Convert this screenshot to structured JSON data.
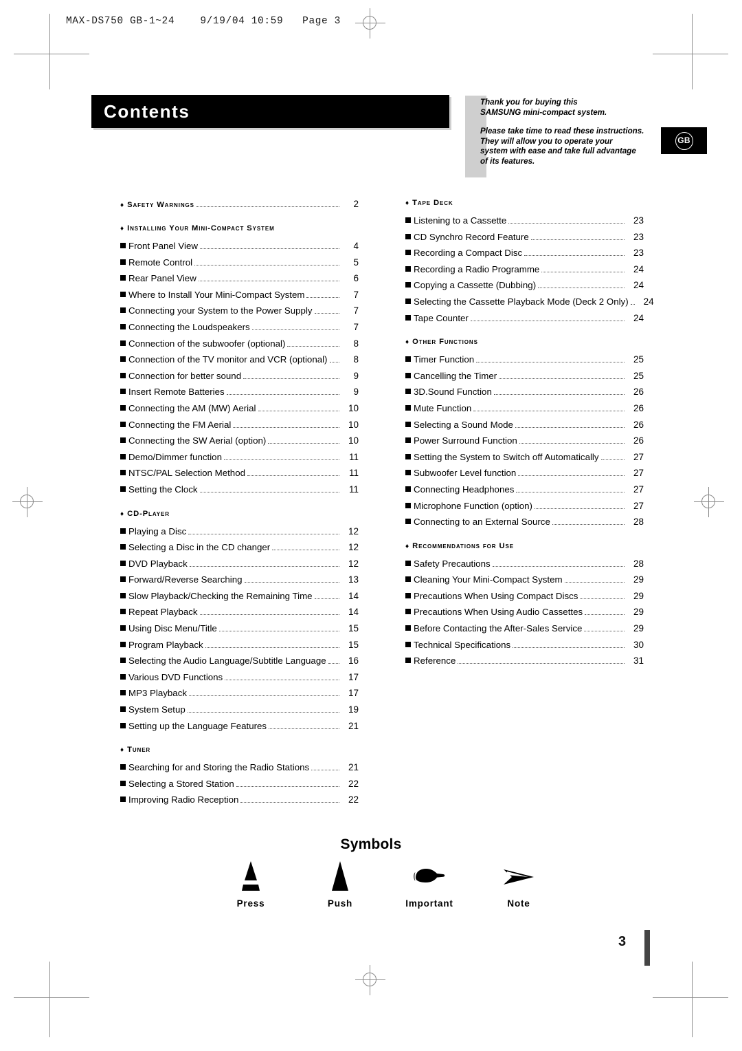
{
  "file_header": "MAX-DS750 GB-1~24    9/19/04 10:59   Page 3",
  "banner": {
    "title": "Contents"
  },
  "intro": {
    "paragraph1_line1": "Thank you for buying this",
    "paragraph1_line2": "SAMSUNG mini-compact system.",
    "paragraph2_line1": "Please take time to read these instructions.",
    "paragraph2_line2": "They will allow you to operate your",
    "paragraph2_line3": "system with ease and take full advantage",
    "paragraph2_line4": "of its features."
  },
  "region_badge": {
    "label": "GB"
  },
  "toc": {
    "left_column": [
      {
        "type": "section_with_page",
        "label": "Safety Warnings",
        "page": "2",
        "entries": []
      },
      {
        "type": "section",
        "label": "Installing Your Mini-Compact System",
        "entries": [
          {
            "label": "Front Panel View",
            "page": "4"
          },
          {
            "label": "Remote Control",
            "page": "5"
          },
          {
            "label": "Rear Panel View",
            "page": "6"
          },
          {
            "label": "Where to Install Your Mini-Compact System",
            "page": "7"
          },
          {
            "label": "Connecting your System to the Power Supply",
            "page": "7"
          },
          {
            "label": "Connecting the Loudspeakers",
            "page": "7"
          },
          {
            "label": "Connection of the subwoofer (optional)",
            "page": "8"
          },
          {
            "label": "Connection of the TV monitor and VCR (optional)",
            "page": "8"
          },
          {
            "label": "Connection for better sound",
            "page": "9"
          },
          {
            "label": "Insert Remote Batteries",
            "page": "9"
          },
          {
            "label": "Connecting the AM (MW) Aerial",
            "page": "10"
          },
          {
            "label": "Connecting the FM Aerial",
            "page": "10"
          },
          {
            "label": "Connecting the SW Aerial (option)",
            "page": "10"
          },
          {
            "label": "Demo/Dimmer function",
            "page": "11"
          },
          {
            "label": "NTSC/PAL Selection Method",
            "page": "11"
          },
          {
            "label": "Setting the Clock",
            "page": "11"
          }
        ]
      },
      {
        "type": "section",
        "label": "CD-Player",
        "entries": [
          {
            "label": "Playing a Disc",
            "page": "12"
          },
          {
            "label": "Selecting a Disc in the CD changer",
            "page": "12"
          },
          {
            "label": "DVD Playback",
            "page": "12"
          },
          {
            "label": "Forward/Reverse Searching",
            "page": "13"
          },
          {
            "label": "Slow Playback/Checking the Remaining Time",
            "page": "14"
          },
          {
            "label": "Repeat Playback",
            "page": "14"
          },
          {
            "label": "Using Disc Menu/Title",
            "page": "15"
          },
          {
            "label": "Program Playback",
            "page": "15"
          },
          {
            "label": "Selecting the Audio Language/Subtitle Language",
            "page": "16"
          },
          {
            "label": "Various DVD Functions",
            "page": "17"
          },
          {
            "label": "MP3 Playback",
            "page": "17"
          },
          {
            "label": "System Setup",
            "page": "19"
          },
          {
            "label": "Setting up the Language Features",
            "page": "21"
          }
        ]
      },
      {
        "type": "section",
        "label": "Tuner",
        "entries": [
          {
            "label": "Searching for and Storing the Radio Stations",
            "page": "21"
          },
          {
            "label": "Selecting a Stored Station",
            "page": "22"
          },
          {
            "label": "Improving Radio Reception",
            "page": "22"
          }
        ]
      }
    ],
    "right_column": [
      {
        "type": "section",
        "label": "Tape Deck",
        "entries": [
          {
            "label": "Listening to a Cassette",
            "page": "23"
          },
          {
            "label": "CD Synchro Record Feature",
            "page": "23"
          },
          {
            "label": "Recording a Compact Disc",
            "page": "23"
          },
          {
            "label": "Recording a Radio Programme",
            "page": "24"
          },
          {
            "label": "Copying a Cassette (Dubbing)",
            "page": "24"
          },
          {
            "label": "Selecting the Cassette Playback Mode (Deck 2 Only)",
            "page": "24"
          },
          {
            "label": "Tape Counter",
            "page": "24"
          }
        ]
      },
      {
        "type": "section",
        "label": "Other Functions",
        "entries": [
          {
            "label": "Timer Function",
            "page": "25"
          },
          {
            "label": "Cancelling the Timer",
            "page": "25"
          },
          {
            "label": "3D.Sound Function",
            "page": "26"
          },
          {
            "label": "Mute Function",
            "page": "26"
          },
          {
            "label": "Selecting a Sound Mode",
            "page": "26"
          },
          {
            "label": "Power Surround Function",
            "page": "26"
          },
          {
            "label": "Setting the System to Switch off Automatically",
            "page": "27"
          },
          {
            "label": "Subwoofer Level function",
            "page": "27"
          },
          {
            "label": "Connecting Headphones",
            "page": "27"
          },
          {
            "label": "Microphone Function (option)",
            "page": "27"
          },
          {
            "label": "Connecting to an External Source",
            "page": "28"
          }
        ]
      },
      {
        "type": "section",
        "label": "Recommendations for Use",
        "entries": [
          {
            "label": "Safety Precautions",
            "page": "28"
          },
          {
            "label": "Cleaning Your Mini-Compact System",
            "page": "29"
          },
          {
            "label": "Precautions When Using Compact Discs",
            "page": "29"
          },
          {
            "label": "Precautions When Using Audio Cassettes",
            "page": "29"
          },
          {
            "label": "Before Contacting the After-Sales Service",
            "page": "29"
          },
          {
            "label": "Technical Specifications",
            "page": "30"
          },
          {
            "label": "Reference",
            "page": "31"
          }
        ]
      }
    ]
  },
  "symbols": {
    "heading": "Symbols",
    "items": [
      {
        "label": "Press",
        "icon": "split-triangle-icon"
      },
      {
        "label": "Push",
        "icon": "solid-triangle-icon"
      },
      {
        "label": "Important",
        "icon": "pointing-hand-icon"
      },
      {
        "label": "Note",
        "icon": "arrow-dart-icon"
      }
    ]
  },
  "page_number": "3"
}
